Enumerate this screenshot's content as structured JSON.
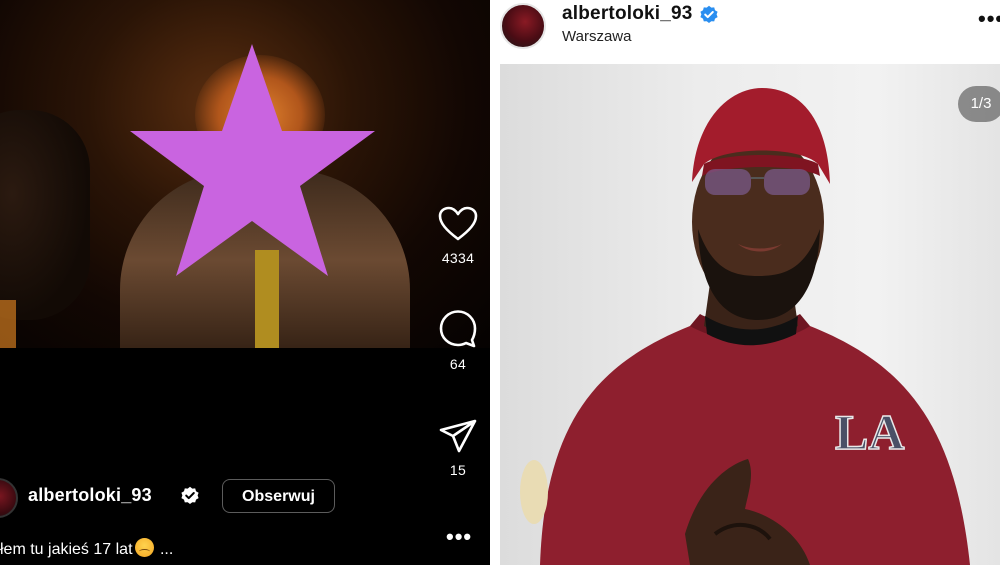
{
  "left_post": {
    "username": "albertoloki_93",
    "follow_label": "Obserwuj",
    "caption": "łem tu jakieś 17 lat",
    "caption_ellipsis": "...",
    "more": "•••",
    "actions": [
      {
        "icon": "heart-icon",
        "count": "4334"
      },
      {
        "icon": "comment-icon",
        "count": "64"
      },
      {
        "icon": "share-icon",
        "count": "15"
      }
    ],
    "censor_color": "#c964e0"
  },
  "right_post": {
    "username": "albertoloki_93",
    "location": "Warszawa",
    "more": "•••",
    "counter": "1/3",
    "verified_color": "#2a8ef0",
    "shirt_color": "#8e1f2e",
    "durag_color": "#a31c2c",
    "logo_text": "LA"
  }
}
